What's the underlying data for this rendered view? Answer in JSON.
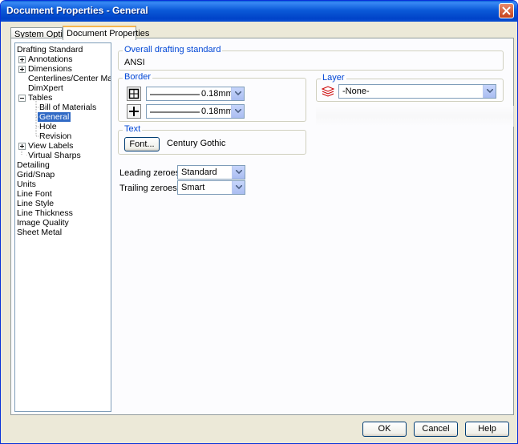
{
  "window": {
    "title": "Document Properties - General"
  },
  "tabs": [
    {
      "label": "System Options"
    },
    {
      "label": "Document Properties"
    }
  ],
  "tree": {
    "items": [
      {
        "label": "Drafting Standard"
      },
      {
        "label": "Annotations"
      },
      {
        "label": "Dimensions"
      },
      {
        "label": "Centerlines/Center Marks"
      },
      {
        "label": "DimXpert"
      },
      {
        "label": "Tables"
      },
      {
        "label": "Bill of Materials"
      },
      {
        "label": "General"
      },
      {
        "label": "Hole"
      },
      {
        "label": "Revision"
      },
      {
        "label": "View Labels"
      },
      {
        "label": "Virtual Sharps"
      },
      {
        "label": "Detailing"
      },
      {
        "label": "Grid/Snap"
      },
      {
        "label": "Units"
      },
      {
        "label": "Line Font"
      },
      {
        "label": "Line Style"
      },
      {
        "label": "Line Thickness"
      },
      {
        "label": "Image Quality"
      },
      {
        "label": "Sheet Metal"
      }
    ],
    "selected": "General"
  },
  "overall": {
    "label": "Overall drafting standard",
    "value": "ANSI"
  },
  "border": {
    "label": "Border",
    "outer_thickness": "0.18mm",
    "inner_thickness": "0.18mm",
    "outer_icon": "border-outer-icon",
    "inner_icon": "border-inner-icon"
  },
  "layer": {
    "label": "Layer",
    "value": "-None-",
    "icon": "layers-icon"
  },
  "text": {
    "label": "Text",
    "font_button": "Font...",
    "font_name": "Century Gothic"
  },
  "zeroes": {
    "leading_label": "Leading zeroes:",
    "leading_value": "Standard",
    "trailing_label": "Trailing zeroes:",
    "trailing_value": "Smart"
  },
  "buttons": {
    "ok": "OK",
    "cancel": "Cancel",
    "help": "Help"
  },
  "colors": {
    "accent": "#0046d5",
    "selection": "#316ac5",
    "title_bar": "#0054e3"
  }
}
